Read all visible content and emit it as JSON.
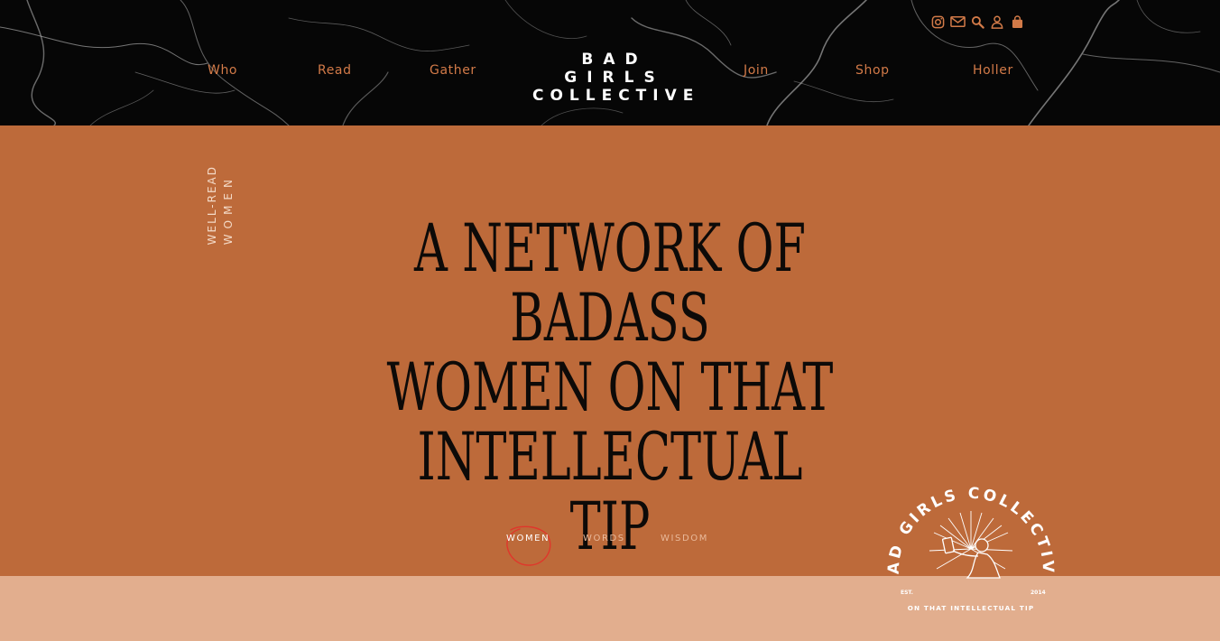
{
  "brand": {
    "logo_line1": "BAD GIRLS",
    "logo_line2": "COLLECTIVE"
  },
  "nav": {
    "left": [
      "Who",
      "Read",
      "Gather"
    ],
    "right": [
      "Join",
      "Shop",
      "Holler"
    ]
  },
  "utility_icons": [
    "instagram-icon",
    "mail-icon",
    "search-icon",
    "user-icon",
    "bag-icon"
  ],
  "hero": {
    "vertical_line1": "WELL-READ",
    "vertical_line2": "WOMEN",
    "headline_line1": "A NETWORK OF BADASS",
    "headline_line2": "WOMEN ON THAT",
    "headline_line3": "INTELLECTUAL TIP",
    "tabs": [
      {
        "label": "WOMEN",
        "active": true
      },
      {
        "label": "WORDS",
        "active": false
      },
      {
        "label": "WISDOM",
        "active": false
      }
    ]
  },
  "badge": {
    "top_text": "BAD GIRLS COLLECTIVE",
    "est_label": "EST.",
    "year": "2014",
    "bottom_text": "ON THAT INTELLECTUAL TIP"
  },
  "colors": {
    "header_bg": "#060606",
    "accent": "#d27a48",
    "hero_bg": "#bd6a3a",
    "footer_band": "#e2ae8e",
    "circle": "#e0362b"
  }
}
